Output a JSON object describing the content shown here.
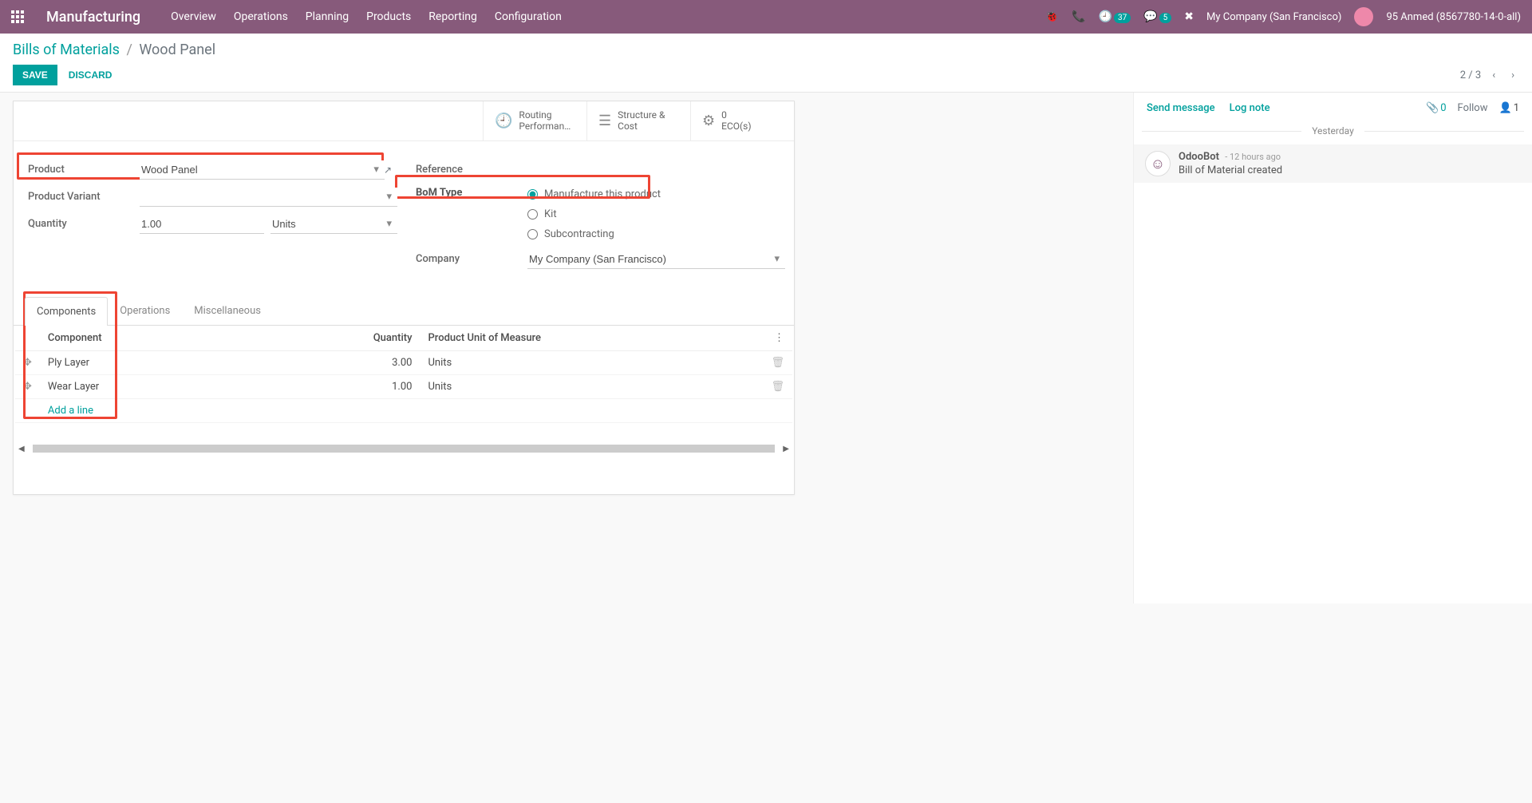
{
  "nav": {
    "brand": "Manufacturing",
    "menu": [
      "Overview",
      "Operations",
      "Planning",
      "Products",
      "Reporting",
      "Configuration"
    ],
    "activity_badge": "37",
    "chat_badge": "5",
    "company": "My Company (San Francisco)",
    "user": "95 Anmed (8567780-14-0-all)"
  },
  "breadcrumb": {
    "root": "Bills of Materials",
    "current": "Wood Panel"
  },
  "buttons": {
    "save": "SAVE",
    "discard": "DISCARD"
  },
  "pager": {
    "text": "2 / 3"
  },
  "statbuttons": {
    "routing": {
      "line1": "Routing",
      "line2": "Performan…"
    },
    "structure": {
      "line1": "Structure &",
      "line2": "Cost"
    },
    "eco": {
      "num": "0",
      "label": "ECO(s)"
    }
  },
  "form": {
    "labels": {
      "product": "Product",
      "variant": "Product Variant",
      "quantity": "Quantity",
      "reference": "Reference",
      "bomtype": "BoM Type",
      "company": "Company"
    },
    "product": "Wood Panel",
    "variant": "",
    "quantity": "1.00",
    "uom": "Units",
    "reference": "",
    "bomtype_opts": {
      "manufacture": "Manufacture this product",
      "kit": "Kit",
      "subcontract": "Subcontracting"
    },
    "company_value": "My Company (San Francisco)"
  },
  "tabs": {
    "components": "Components",
    "operations": "Operations",
    "misc": "Miscellaneous"
  },
  "table": {
    "headers": {
      "component": "Component",
      "quantity": "Quantity",
      "uom": "Product Unit of Measure"
    },
    "rows": [
      {
        "name": "Ply Layer",
        "qty": "3.00",
        "uom": "Units"
      },
      {
        "name": "Wear Layer",
        "qty": "1.00",
        "uom": "Units"
      }
    ],
    "addline": "Add a line"
  },
  "chatter": {
    "send": "Send message",
    "lognote": "Log note",
    "attcount": "0",
    "follow": "Follow",
    "followers": "1",
    "divider": "Yesterday",
    "msg": {
      "author": "OdooBot",
      "time": "- 12 hours ago",
      "body": "Bill of Material created"
    }
  }
}
